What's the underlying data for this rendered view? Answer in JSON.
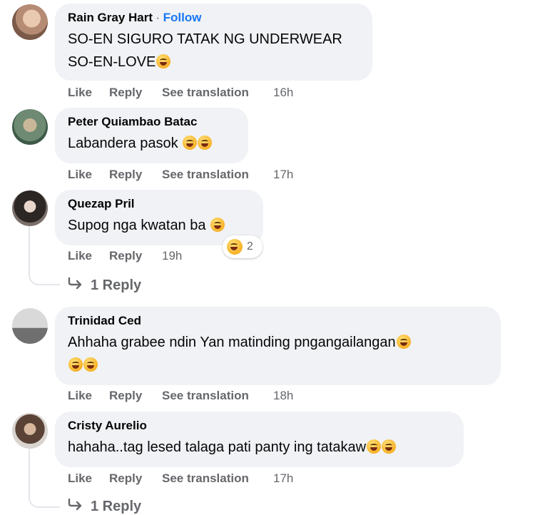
{
  "comments": [
    {
      "author": "Rain Gray Hart",
      "separator": "·",
      "follow": "Follow",
      "line1": "SO-EN SIGURO TATAK NG UNDERWEAR",
      "line2": "SO-EN-LOVE",
      "actions": {
        "like": "Like",
        "reply": "Reply",
        "translate": "See translation",
        "time": "16h"
      }
    },
    {
      "author": "Peter Quiambao Batac",
      "line1": "Labandera pasok",
      "actions": {
        "like": "Like",
        "reply": "Reply",
        "translate": "See translation",
        "time": "17h"
      }
    },
    {
      "author": "Quezap Pril",
      "line1": "Supog nga kwatan ba",
      "reaction_count": "2",
      "actions": {
        "like": "Like",
        "reply": "Reply",
        "time": "19h"
      },
      "replies_label": "1 Reply"
    },
    {
      "author": "Trinidad Ced",
      "line1": "Ahhaha grabee ndin Yan matinding pngangailangan",
      "actions": {
        "like": "Like",
        "reply": "Reply",
        "translate": "See translation",
        "time": "18h"
      }
    },
    {
      "author": "Cristy Aurelio",
      "line1": "hahaha..tag lesed talaga pati panty ing tatakaw",
      "actions": {
        "like": "Like",
        "reply": "Reply",
        "translate": "See translation",
        "time": "17h"
      },
      "replies_label": "1 Reply"
    }
  ],
  "icons": {
    "emoji": "rolling-on-floor-laughing",
    "reply_arrow": "reply-arrow-icon"
  },
  "colors": {
    "bubble": "#f0f2f5",
    "follow": "#1877f2",
    "muted": "#65676b"
  }
}
